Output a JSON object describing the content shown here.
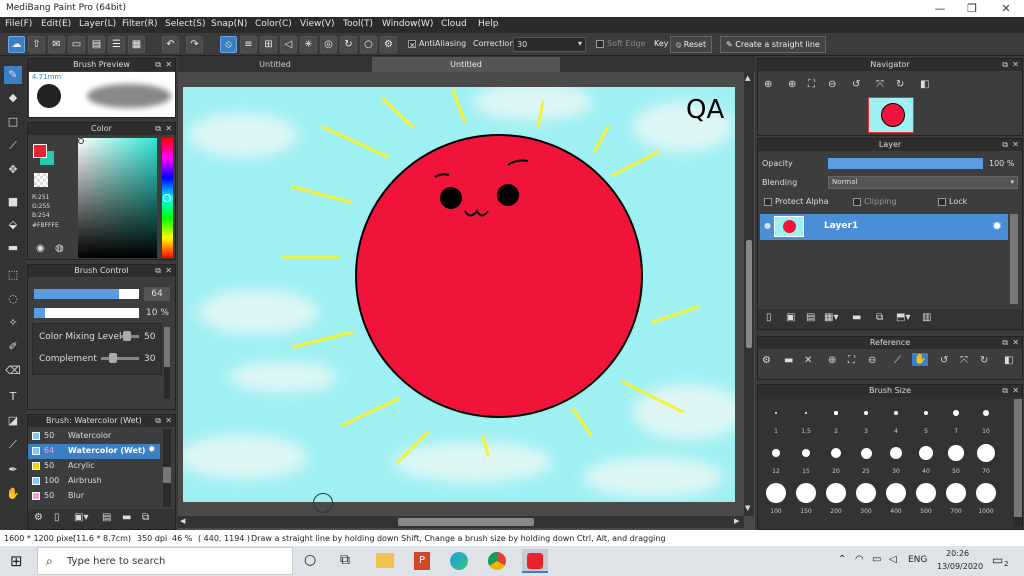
{
  "window": {
    "title": "MediBang Paint Pro (64bit)",
    "minimize": "—",
    "restore": "❐",
    "close": "✕"
  },
  "menu": [
    "File(F)",
    "Edit(E)",
    "Layer(L)",
    "Filter(R)",
    "Select(S)",
    "Snap(N)",
    "Color(C)",
    "View(V)",
    "Tool(T)",
    "Window(W)",
    "Cloud",
    "Help"
  ],
  "toolbar": {
    "antialiasing": "AntiAliasing",
    "correction_label": "Correction",
    "correction_value": "30",
    "soft_edge": "Soft Edge",
    "key": "Key",
    "reset": "Reset",
    "straight_line": "Create a straight line"
  },
  "brush_preview": {
    "title": "Brush Preview",
    "size": "4.71mm"
  },
  "color": {
    "title": "Color",
    "r": "R:251",
    "g": "G:255",
    "b": "B:254",
    "hex": "#FBFFFE",
    "primary": "#e8232f",
    "secondary": "#28c9b4"
  },
  "brush_control": {
    "title": "Brush Control",
    "size": "64",
    "opacity": "10 %",
    "mixing_label": "Color Mixing Level",
    "mixing_value": "50",
    "complement_label": "Complement",
    "complement_value": "30"
  },
  "brush_list": {
    "title": "Brush: Watercolor (Wet)",
    "items": [
      {
        "size": "50",
        "name": "Watercolor",
        "color": "#7ec8ff"
      },
      {
        "size": "64",
        "name": "Watercolor (Wet)",
        "color": "#7ec8ff"
      },
      {
        "size": "50",
        "name": "Acrylic",
        "color": "#f5d400"
      },
      {
        "size": "100",
        "name": "Airbrush",
        "color": "#7ec8ff"
      },
      {
        "size": "50",
        "name": "Blur",
        "color": "#f29fd8"
      }
    ]
  },
  "tabs": [
    "Untitled",
    "Untitled"
  ],
  "artwork": {
    "text": "QA"
  },
  "navigator": {
    "title": "Navigator"
  },
  "layer": {
    "title": "Layer",
    "opacity_label": "Opacity",
    "opacity_value": "100 %",
    "blending_label": "Blending",
    "blending_value": "Normal",
    "protect_alpha": "Protect Alpha",
    "clipping": "Clipping",
    "lock": "Lock",
    "layer_name": "Layer1"
  },
  "reference": {
    "title": "Reference"
  },
  "brush_size": {
    "title": "Brush Size",
    "sizes": [
      "1",
      "1.5",
      "2",
      "3",
      "4",
      "5",
      "7",
      "10",
      "12",
      "15",
      "20",
      "25",
      "30",
      "40",
      "50",
      "70",
      "100",
      "150",
      "200",
      "300",
      "400",
      "500",
      "700",
      "1000"
    ]
  },
  "status": {
    "size": "1600 * 1200 pixel",
    "physical": "(11.6 * 8.7cm)",
    "dpi": "350 dpi",
    "zoom": "46 %",
    "coords": "( 440, 1194 )",
    "hint": "Draw a straight line by holding down Shift, Change a brush size by holding down Ctrl, Alt, and dragging"
  },
  "taskbar": {
    "search": "Type here to search",
    "lang": "ENG",
    "time": "20:26",
    "date": "13/09/2020",
    "notifications": "2"
  }
}
